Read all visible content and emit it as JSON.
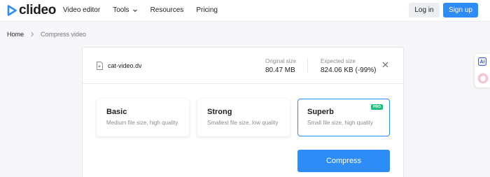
{
  "header": {
    "logo_text": "clideo",
    "nav": [
      {
        "label": "Video editor"
      },
      {
        "label": "Tools",
        "has_dropdown": true
      },
      {
        "label": "Resources"
      },
      {
        "label": "Pricing"
      }
    ],
    "login_label": "Log in",
    "signup_label": "Sign up"
  },
  "breadcrumb": {
    "home": "Home",
    "current": "Compress video"
  },
  "file": {
    "name": "cat-video.dv",
    "original_label": "Original size",
    "original_value": "80.47 MB",
    "expected_label": "Expected size",
    "expected_value": "824.06 KB (-99%)"
  },
  "options": [
    {
      "title": "Basic",
      "description": "Medium file size, high quality"
    },
    {
      "title": "Strong",
      "description": "Smallest file size, low quality"
    },
    {
      "title": "Superb",
      "description": "Small file size, high quality",
      "badge": "PRO",
      "selected": true
    }
  ],
  "compress_label": "Compress",
  "colors": {
    "accent": "#2d8cf5",
    "pro_badge": "#1fbf7e",
    "logo": "#2d8cf5"
  },
  "icons": {
    "logo": "play-triangle-icon",
    "file": "file-icon",
    "close": "close-icon",
    "dropdown": "chevron-down-icon",
    "breadcrumb_sep": "chevron-right-icon",
    "side_ai": "ai-translate-icon",
    "side_hand": "hand-wave-icon"
  }
}
